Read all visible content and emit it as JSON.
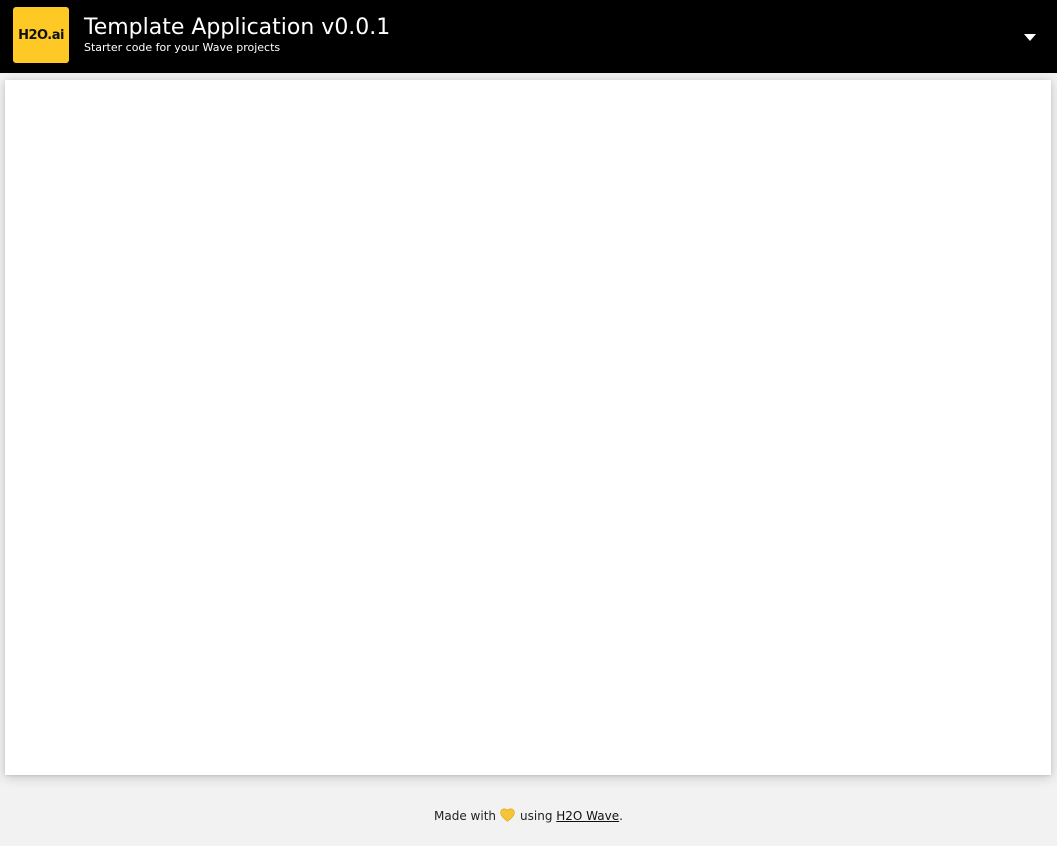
{
  "header": {
    "logo_text": "H2O.ai",
    "title": "Template Application v0.0.1",
    "subtitle": "Starter code for your Wave projects",
    "logo_color": "#fec925",
    "background_color": "#000000",
    "dropdown_icon": "caret-down-icon"
  },
  "footer": {
    "prefix": "Made with",
    "heart_icon": "yellow-heart-icon",
    "heart_color": "#f5c43a",
    "middle": "using",
    "link_text": "H2O Wave",
    "suffix": "."
  }
}
